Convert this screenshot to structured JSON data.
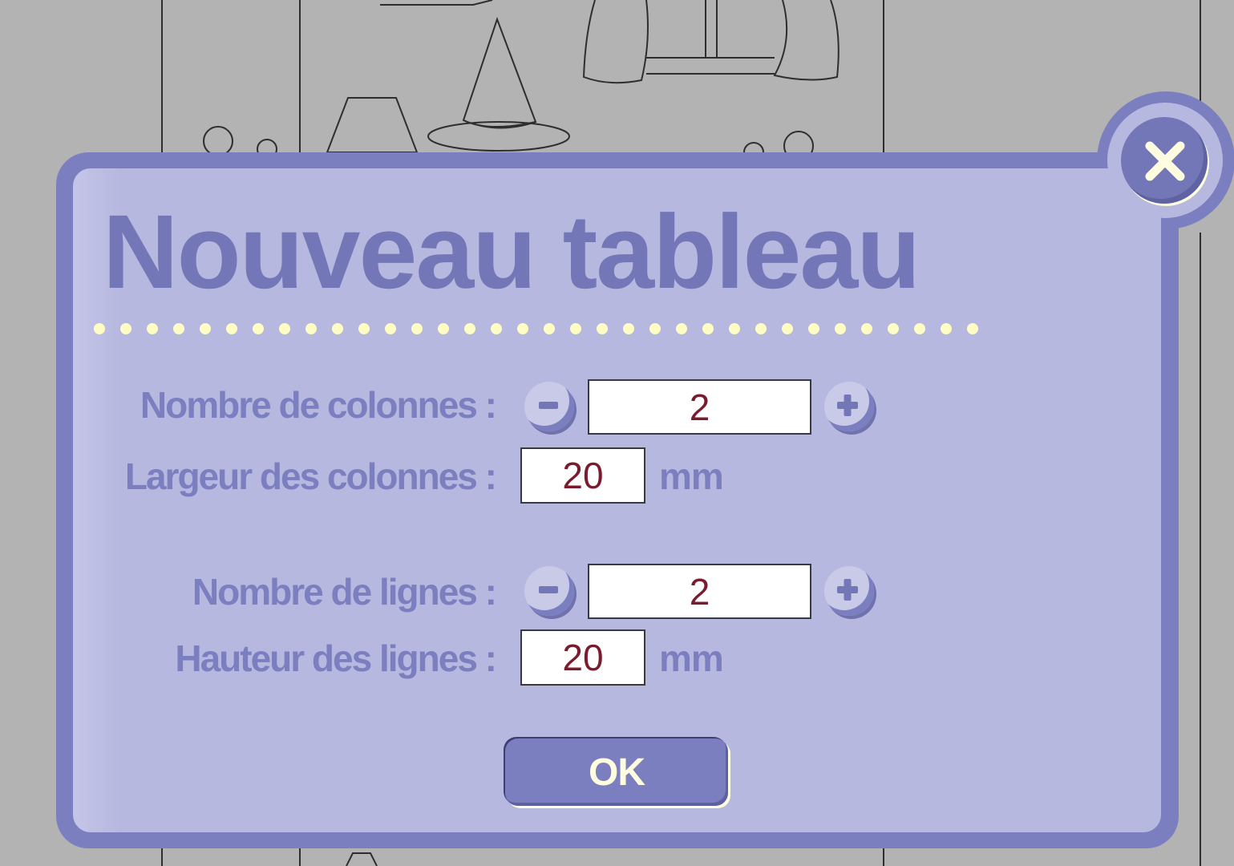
{
  "dialog": {
    "title": "Nouveau tableau",
    "close_icon": "close-x-icon",
    "columns": {
      "count_label": "Nombre de colonnes :",
      "count_value": "2",
      "width_label": "Largeur des colonnes :",
      "width_value": "20",
      "width_unit": "mm"
    },
    "rows": {
      "count_label": "Nombre de lignes :",
      "count_value": "2",
      "height_label": "Hauteur des lignes :",
      "height_value": "20",
      "height_unit": "mm"
    },
    "ok_label": "OK"
  },
  "colors": {
    "accent": "#7b7fc0",
    "panel": "#b7b8df",
    "highlight": "#fffde0",
    "value_text": "#7a1c2e",
    "backdrop": "#b3b3b3"
  }
}
